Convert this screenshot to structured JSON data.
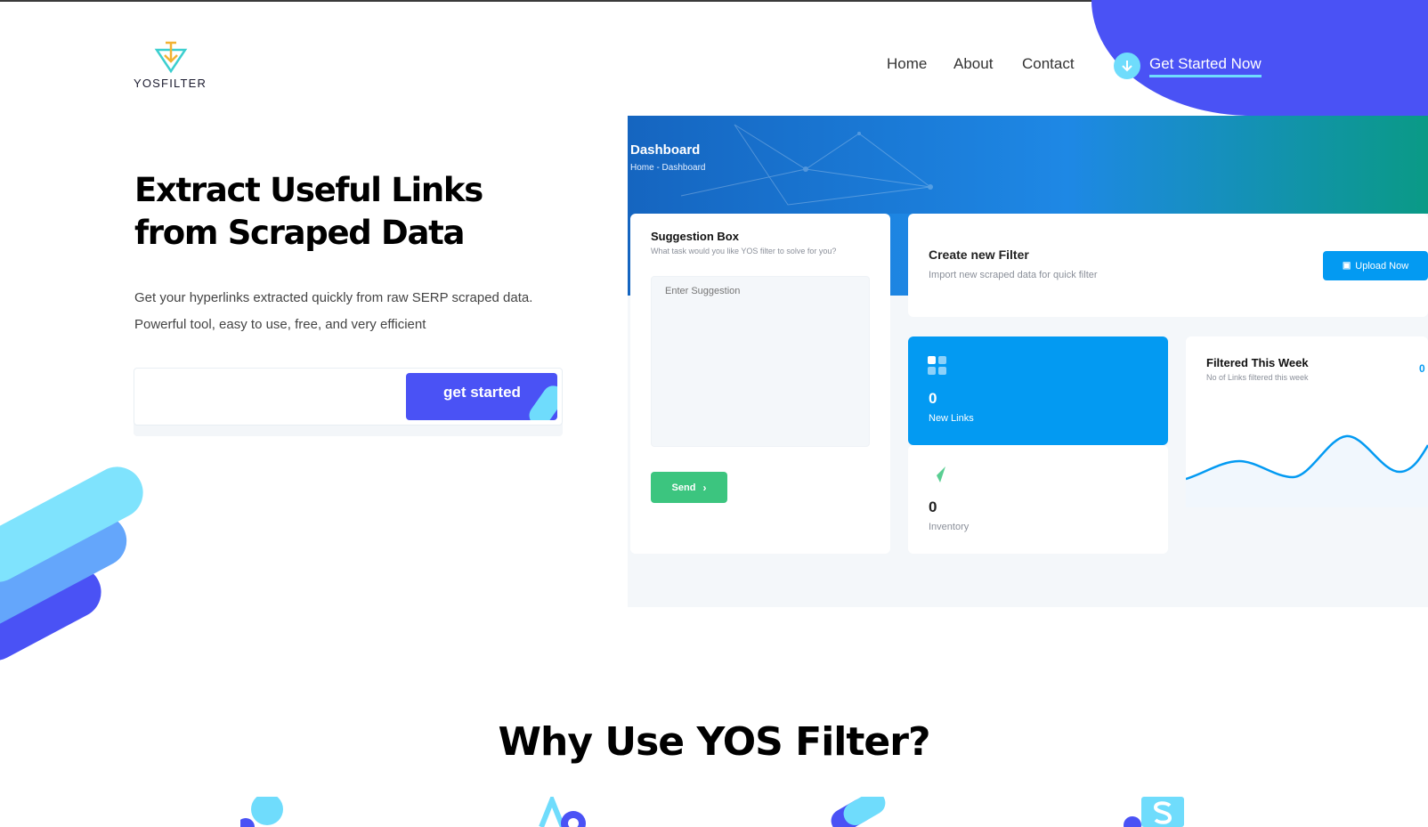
{
  "brand": {
    "name": "YOSFILTER"
  },
  "nav": {
    "home": "Home",
    "about": "About",
    "contact": "Contact",
    "cta": "Get Started Now"
  },
  "hero": {
    "title": "Extract Useful Links from Scraped Data",
    "subtitle": "Get your hyperlinks extracted quickly from raw SERP scraped data. Powerful tool, easy to use, free, and very efficient",
    "input_value": "",
    "button": "get started"
  },
  "dashboard": {
    "title": "Dashboard",
    "breadcrumb": "Home - Dashboard",
    "suggestion": {
      "title": "Suggestion Box",
      "subtitle": "What task would you like YOS filter to solve for you?",
      "placeholder": "Enter Suggestion",
      "send": "Send"
    },
    "create": {
      "title": "Create new Filter",
      "subtitle": "Import new scraped data for quick filter",
      "upload": "Upload Now"
    },
    "stats": {
      "new_links_value": "0",
      "new_links_label": "New Links",
      "inventory_value": "0",
      "inventory_label": "Inventory"
    },
    "week": {
      "title": "Filtered This Week",
      "subtitle": "No of Links filtered this week",
      "value": "0"
    }
  },
  "why": {
    "title": "Why Use YOS Filter?"
  },
  "colors": {
    "primary": "#4a52f5",
    "accent": "#6fdcfc",
    "dash_blue": "#039af2",
    "success": "#3cc57f"
  },
  "icons": [
    "funnel-logo-icon",
    "arrow-down-icon",
    "grid-icon",
    "paper-plane-icon",
    "upload-file-icon",
    "chevron-right-icon"
  ]
}
